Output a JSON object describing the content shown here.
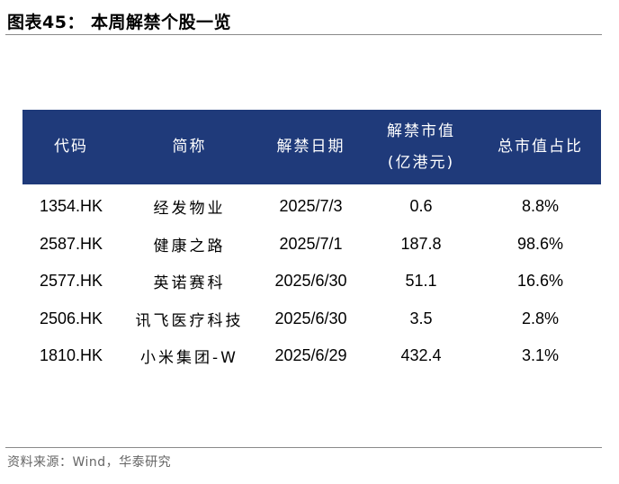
{
  "title": "图表45： 本周解禁个股一览",
  "table": {
    "headers": [
      "代码",
      "简称",
      "解禁日期",
      "解禁市值",
      "(亿港元)",
      "总市值占比"
    ],
    "rows": [
      [
        "1354.HK",
        "经发物业",
        "2025/7/3",
        "0.6",
        "8.8%"
      ],
      [
        "2587.HK",
        "健康之路",
        "2025/7/1",
        "187.8",
        "98.6%"
      ],
      [
        "2577.HK",
        "英诺赛科",
        "2025/6/30",
        "51.1",
        "16.6%"
      ],
      [
        "2506.HK",
        "讯飞医疗科技",
        "2025/6/30",
        "3.5",
        "2.8%"
      ],
      [
        "1810.HK",
        "小米集团-W",
        "2025/6/29",
        "432.4",
        "3.1%"
      ]
    ]
  },
  "source": "资料来源：Wind，华泰研究",
  "colors": {
    "header_bg": "#1f3a7a",
    "header_text": "#ffffff",
    "rule": "#8a8a8a"
  }
}
